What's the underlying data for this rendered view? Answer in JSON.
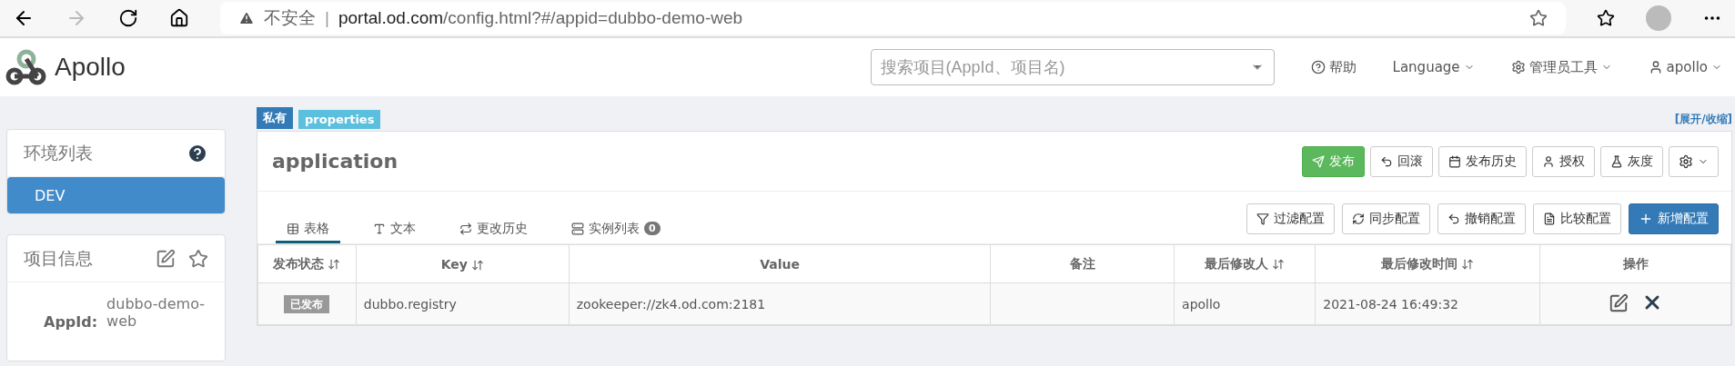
{
  "browser": {
    "security": "不安全",
    "separator": "|",
    "url_host": "portal.od.com",
    "url_path": "/config.html?#/appid=dubbo-demo-web"
  },
  "header": {
    "logo": "Apollo",
    "search": {
      "placeholder": "搜索项目(AppId、项目名)"
    },
    "nav": [
      "帮助",
      "Language",
      "管理员工具",
      "apollo"
    ]
  },
  "sidebar": {
    "env_title": "环境列表",
    "envs": [
      {
        "label": "DEV",
        "selected": true
      }
    ],
    "info_title": "项目信息",
    "info": [
      {
        "label": "AppId:",
        "value": "dubbo-demo-web"
      }
    ]
  },
  "namespace": {
    "tags": [
      {
        "label": "私有",
        "color": "#337ab7"
      },
      {
        "label": "properties",
        "color": "#5bc0de"
      }
    ],
    "toggle": "[展开/收缩]",
    "title": "application",
    "actions": [
      {
        "label": "发布",
        "kind": "primary"
      },
      {
        "label": "回滚",
        "kind": "default"
      },
      {
        "label": "发布历史",
        "kind": "default"
      },
      {
        "label": "授权",
        "kind": "default"
      },
      {
        "label": "灰度",
        "kind": "default"
      },
      {
        "kind": "settings"
      }
    ],
    "tabs": [
      {
        "label": "表格",
        "selected": true
      },
      {
        "label": "文本",
        "selected": false
      },
      {
        "label": "更改历史",
        "selected": false
      },
      {
        "label": "实例列表",
        "selected": false,
        "badge": "0"
      }
    ],
    "tools": [
      {
        "label": "过滤配置",
        "kind": "default"
      },
      {
        "label": "同步配置",
        "kind": "default"
      },
      {
        "label": "撤销配置",
        "kind": "default"
      },
      {
        "label": "比较配置",
        "kind": "default"
      },
      {
        "label": "新增配置",
        "kind": "primary"
      }
    ],
    "table": {
      "columns": [
        {
          "label": "发布状态",
          "sortable": true
        },
        {
          "label": "Key",
          "sortable": true
        },
        {
          "label": "Value",
          "sortable": false
        },
        {
          "label": "备注",
          "sortable": false
        },
        {
          "label": "最后修改人",
          "sortable": true
        },
        {
          "label": "最后修改时间",
          "sortable": true
        },
        {
          "label": "操作",
          "sortable": false
        }
      ],
      "rows": [
        {
          "status": "已发布",
          "key": "dubbo.registry",
          "value": "zookeeper://zk4.od.com:2181",
          "comment": "",
          "modifier": "apollo",
          "time": "2021-08-24 16:49:32"
        }
      ]
    }
  }
}
